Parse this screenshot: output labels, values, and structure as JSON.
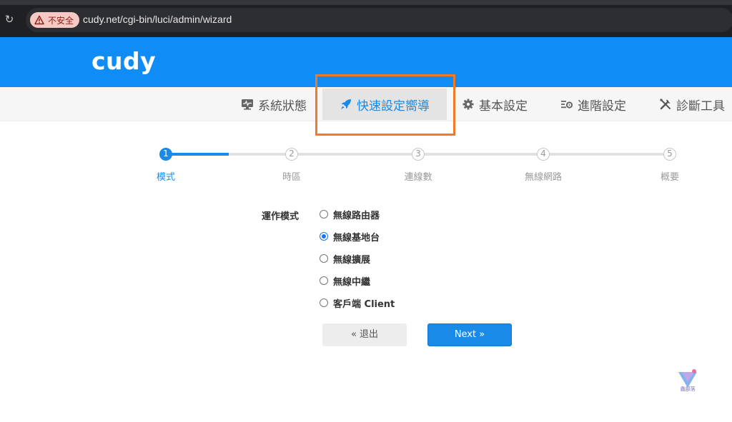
{
  "browser": {
    "security_label": "不安全",
    "url": "cudy.net/cgi-bin/luci/admin/wizard"
  },
  "brand": {
    "logo": "cudy"
  },
  "nav": {
    "items": [
      {
        "label": "系統狀態",
        "icon": "monitor-icon"
      },
      {
        "label": "快速設定嚮導",
        "icon": "rocket-icon",
        "active": true
      },
      {
        "label": "基本設定",
        "icon": "gear-icon"
      },
      {
        "label": "進階設定",
        "icon": "settings-list-icon"
      },
      {
        "label": "診斷工具",
        "icon": "tools-icon"
      }
    ]
  },
  "steps": [
    {
      "number": "1",
      "label": "模式",
      "active": true
    },
    {
      "number": "2",
      "label": "時區"
    },
    {
      "number": "3",
      "label": "連線數"
    },
    {
      "number": "4",
      "label": "無線網路"
    },
    {
      "number": "5",
      "label": "概要"
    }
  ],
  "form": {
    "mode_label": "運作模式",
    "options": [
      {
        "label": "無線路由器",
        "checked": false
      },
      {
        "label": "無線基地台",
        "checked": true
      },
      {
        "label": "無線擴展",
        "checked": false
      },
      {
        "label": "無線中繼",
        "checked": false
      },
      {
        "label": "客戶端 Client",
        "checked": false
      }
    ]
  },
  "buttons": {
    "exit_label": "« 退出",
    "next_label": "Next »"
  },
  "colors": {
    "brand_blue": "#0f8cf5",
    "accent": "#1a8ae8",
    "highlight_box": "#ee7a2a"
  },
  "watermark": {
    "text": "蟲部落"
  }
}
